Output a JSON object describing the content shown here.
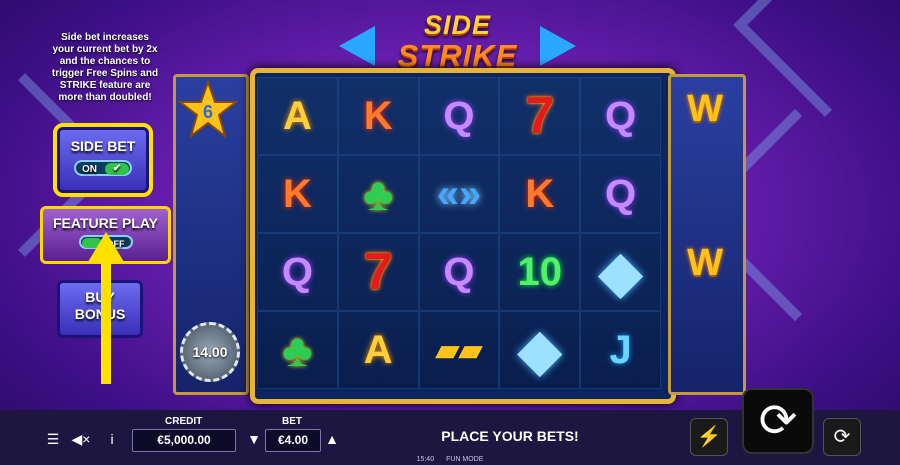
{
  "game": {
    "logo_line1": "SIDE",
    "logo_line2": "STRIKE"
  },
  "side_panel": {
    "tooltip": "Side bet increases your current bet by 2x and the chances to trigger Free Spins and STRIKE feature are more than doubled!",
    "side_bet": {
      "label": "SIDE BET",
      "toggle_label": "ON",
      "toggle_state": "on"
    },
    "feature_play": {
      "label": "FEATURE PLAY",
      "toggle_label": "OFF",
      "toggle_state": "off"
    },
    "buy_bonus": {
      "label_line1": "BUY",
      "label_line2": "BONUS"
    },
    "highlight_color": "#ffe100"
  },
  "reels": {
    "grid": [
      [
        "A",
        "K",
        "Q",
        "7",
        "Q"
      ],
      [
        "K",
        "clover",
        "strike",
        "K",
        "Q"
      ],
      [
        "Q",
        "7",
        "Q",
        "10",
        "diamond"
      ],
      [
        "clover",
        "A",
        "gold",
        "diamond",
        "J"
      ]
    ],
    "left_reel": {
      "star_value": "6",
      "coin_value": "14.00"
    },
    "right_reel": {
      "symbol_top": "W",
      "symbol_bottom": "W"
    }
  },
  "bottom_bar": {
    "credit_label": "CREDIT",
    "credit_value": "€5,000.00",
    "bet_label": "BET",
    "bet_value": "€4.00",
    "message": "PLACE YOUR BETS!",
    "icons": [
      "menu-icon",
      "sound-off-icon",
      "info-icon",
      "bet-down-icon",
      "bet-up-icon",
      "turbo-icon",
      "spin-icon",
      "autoplay-icon"
    ]
  },
  "footer": {
    "time": "15:40",
    "mode": "FUN MODE"
  }
}
